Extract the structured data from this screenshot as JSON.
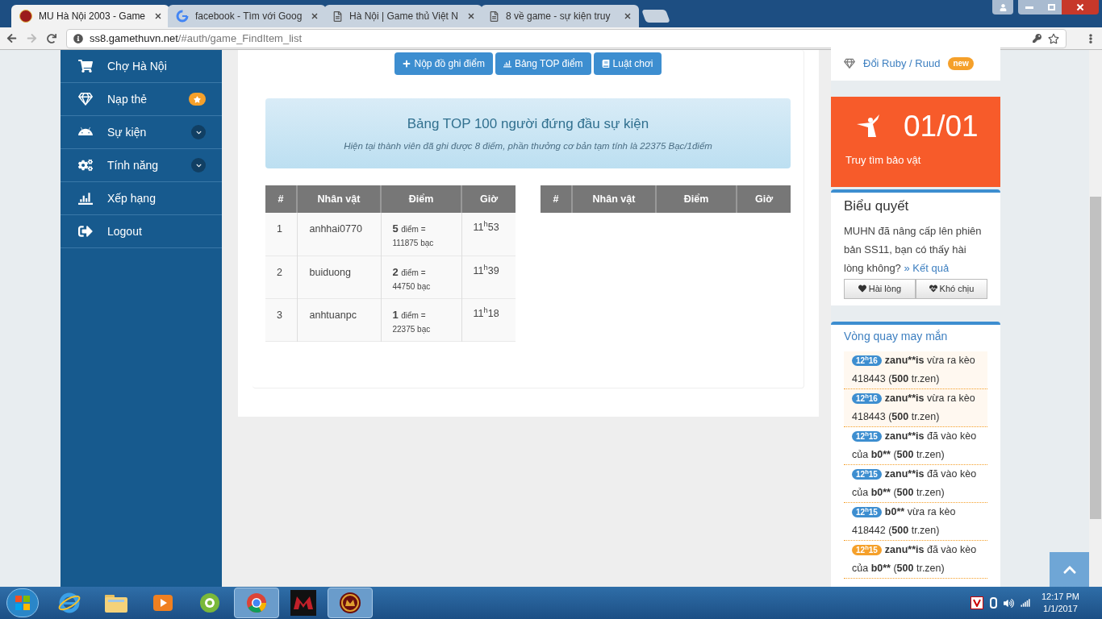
{
  "browser": {
    "tabs": [
      {
        "title": "MU Hà Nội 2003 - Game",
        "selected": true
      },
      {
        "title": "facebook - Tìm với Goog",
        "selected": false
      },
      {
        "title": "Hà Nội | Game thủ Việt N",
        "selected": false
      },
      {
        "title": "8 về game - sự kiện truy",
        "selected": false
      }
    ],
    "url_host": "ss8.gamethuvn.net",
    "url_path": "/#auth/game_FindItem_list"
  },
  "sidebar": {
    "items": [
      {
        "label": "Chợ Hà Nội",
        "kind": "plain"
      },
      {
        "label": "Nạp thẻ",
        "kind": "starred"
      },
      {
        "label": "Sự kiện",
        "kind": "expandable"
      },
      {
        "label": "Tính năng",
        "kind": "expandable"
      },
      {
        "label": "Xếp hạng",
        "kind": "plain"
      },
      {
        "label": "Logout",
        "kind": "plain"
      }
    ]
  },
  "actions": [
    {
      "label": "Nộp đồ ghi điểm"
    },
    {
      "label": "Bảng TOP điểm"
    },
    {
      "label": "Luật chơi"
    }
  ],
  "banner": {
    "title": "Bảng TOP 100 người đứng đầu sự kiện",
    "subtitle": "Hiện tại thành viên đã ghi được 8 điểm, phần thưởng cơ bản tạm tính là 22375 Bạc/1điểm"
  },
  "tables": [
    {
      "columns": [
        "#",
        "Nhân vật",
        "Điểm",
        "Giờ"
      ],
      "rows": [
        {
          "rank": "1",
          "name": "anhhai0770",
          "points": "5",
          "unit": "điểm =",
          "amount": "111875 bạc",
          "time": "11$^{h}$53"
        },
        {
          "rank": "2",
          "name": "buiduong",
          "points": "2",
          "unit": "điểm =",
          "amount": "44750 bạc",
          "time": "11$^{h}$39"
        },
        {
          "rank": "3",
          "name": "anhtuanpc",
          "points": "1",
          "unit": "điểm =",
          "amount": "22375 bạc",
          "time": "11$^{h}$18"
        }
      ]
    },
    {
      "columns": [
        "#",
        "Nhân vật",
        "Điểm",
        "Giờ"
      ]
    }
  ],
  "ruby_link": {
    "label": "Đổi Ruby / Ruud",
    "badge": "new"
  },
  "event_card": {
    "count": "01/01",
    "label": "Truy tìm bảo vật"
  },
  "poll": {
    "title": "Biểu quyết",
    "question": "MUHN đã nâng cấp lên phiên bản SS11, bạn có thấy hài lòng không?",
    "result_link": "» Kết quả",
    "buttons": [
      {
        "label": "Hài lòng"
      },
      {
        "label": "Khó chịu"
      }
    ]
  },
  "wheel": {
    "title": "Vòng quay may mắn",
    "items": [
      {
        "time": "12$^{h}$16",
        "color": "#3d8ed0",
        "highlighted": true,
        "parts": [
          {
            "text": "zanu**is",
            "bold": true
          },
          {
            "text": " vừa ra kèo 418443 (",
            "bold": false
          },
          {
            "text": "500",
            "bold": true
          },
          {
            "text": " tr.zen)",
            "bold": false
          }
        ]
      },
      {
        "time": "12$^{h}$16",
        "color": "#3d8ed0",
        "highlighted": true,
        "parts": [
          {
            "text": "zanu**is",
            "bold": true
          },
          {
            "text": " vừa ra kèo 418443 (",
            "bold": false
          },
          {
            "text": "500",
            "bold": true
          },
          {
            "text": " tr.zen)",
            "bold": false
          }
        ]
      },
      {
        "time": "12$^{h}$15",
        "color": "#3d8ed0",
        "highlighted": false,
        "parts": [
          {
            "text": "zanu**is",
            "bold": true
          },
          {
            "text": " đã vào kèo của ",
            "bold": false
          },
          {
            "text": "b0**",
            "bold": true
          },
          {
            "text": " (",
            "bold": false
          },
          {
            "text": "500",
            "bold": true
          },
          {
            "text": " tr.zen)",
            "bold": false
          }
        ]
      },
      {
        "time": "12$^{h}$15",
        "color": "#3d8ed0",
        "highlighted": false,
        "parts": [
          {
            "text": "zanu**is",
            "bold": true
          },
          {
            "text": " đã vào kèo của ",
            "bold": false
          },
          {
            "text": "b0**",
            "bold": true
          },
          {
            "text": " (",
            "bold": false
          },
          {
            "text": "500",
            "bold": true
          },
          {
            "text": " tr.zen)",
            "bold": false
          }
        ]
      },
      {
        "time": "12$^{h}$15",
        "color": "#3d8ed0",
        "highlighted": false,
        "parts": [
          {
            "text": "b0**",
            "bold": true
          },
          {
            "text": " vừa ra kèo 418442 (",
            "bold": false
          },
          {
            "text": "500",
            "bold": true
          },
          {
            "text": " tr.zen)",
            "bold": false
          }
        ]
      },
      {
        "time": "12$^{h}$15",
        "color": "#f5a02a",
        "highlighted": false,
        "parts": [
          {
            "text": "zanu**is",
            "bold": true
          },
          {
            "text": " đã vào kèo của ",
            "bold": false
          },
          {
            "text": "b0**",
            "bold": true
          },
          {
            "text": " (",
            "bold": false
          },
          {
            "text": "500",
            "bold": true
          },
          {
            "text": " tr.zen)",
            "bold": false
          }
        ]
      }
    ]
  },
  "taskbar": {
    "apps": [
      {
        "active": false
      },
      {
        "active": false
      },
      {
        "active": false
      },
      {
        "active": false
      },
      {
        "active": true
      },
      {
        "active": false
      },
      {
        "active": true
      }
    ],
    "time": "12:17 PM",
    "date": "1/1/2017"
  }
}
